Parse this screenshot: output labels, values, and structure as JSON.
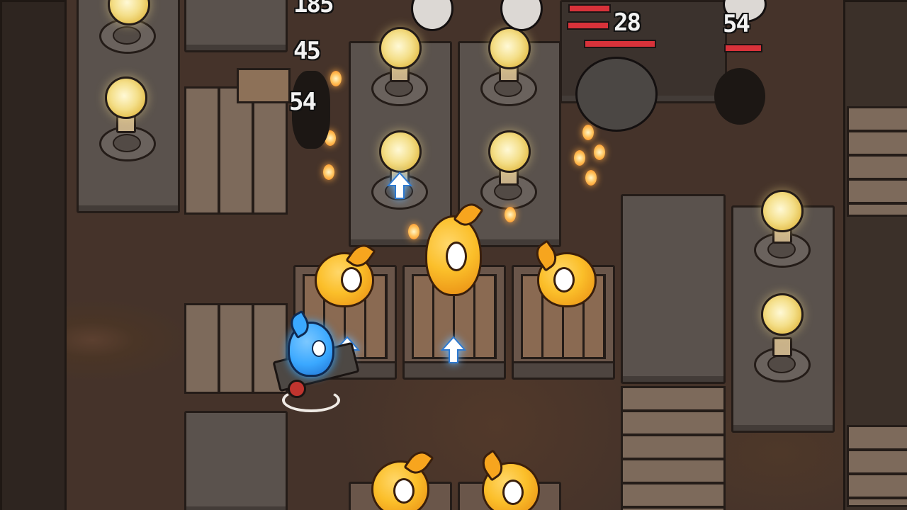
{
  "damage_numbers": [
    {
      "id": "dmg-1",
      "text": "185"
    },
    {
      "id": "dmg-2",
      "text": "45"
    },
    {
      "id": "dmg-3",
      "text": "54"
    },
    {
      "id": "dmg-4",
      "text": "28"
    },
    {
      "id": "dmg-5",
      "text": "54"
    }
  ],
  "colors": {
    "player_aura": "#3aa8ff",
    "ally_slime": "#fbbf2a",
    "upgrade_arrow": "#ffffff",
    "enemy_hp": "#d8323a"
  },
  "icons": [
    "lightbulb-icon",
    "upgrade-arrow-icon",
    "fireball-icon"
  ]
}
